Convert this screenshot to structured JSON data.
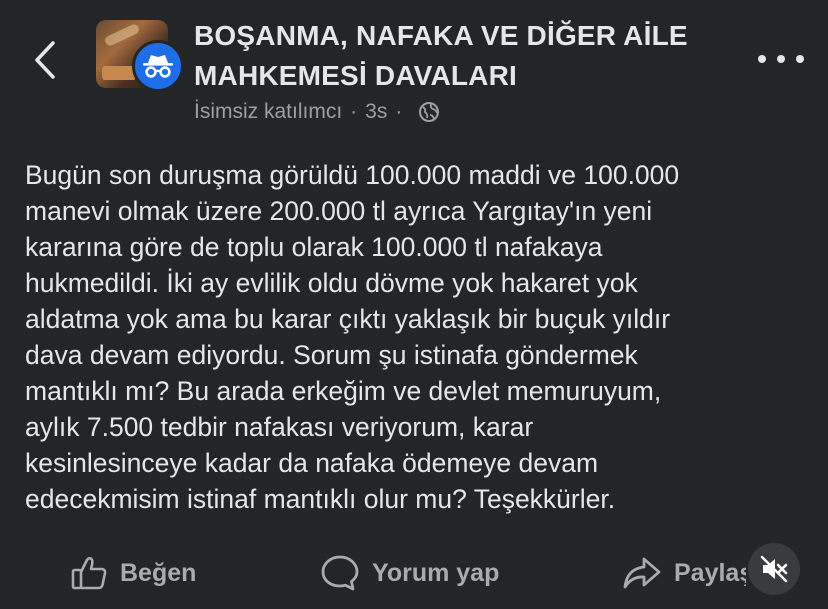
{
  "header": {
    "back_icon": "chevron-left-icon",
    "group_title_line1": "BOŞANMA, NAFAKA VE DİĞER AİLE",
    "group_title_line2": "MAHKEMESİ DAVALARI",
    "author": "İsimsiz katılımcı",
    "separator": "·",
    "time": "3s",
    "privacy_icon": "globe-icon",
    "more_icon": "more-dots-icon"
  },
  "post": {
    "text": "Bugün son duruşma görüldü 100.000 maddi ve 100.000\nmanevi olmak üzere 200.000 tl ayrıca Yargıtay'ın yeni\nkararına göre de toplu olarak 100.000 tl nafakaya\nhukmedildi. İki ay evlilik oldu dövme yok hakaret yok\naldatma yok ama bu karar çıktı yaklaşık bir buçuk yıldır\ndava devam ediyordu. Sorum şu istinafa göndermek\nmantıklı mı? Bu arada erkeğim ve devlet memuruyum,\naylık 7.500 tedbir nafakası veriyorum, karar\nkesinlesinceye kadar da nafaka ödemeye devam\nedecekmisim istinaf mantıklı olur mu? Teşekkürler."
  },
  "actions": {
    "like_label": "Beğen",
    "comment_label": "Yorum yap",
    "share_label": "Paylaş",
    "like_icon": "thumbs-up-icon",
    "comment_icon": "comment-bubble-icon",
    "share_icon": "share-arrow-icon",
    "mute_icon": "muted-speaker-icon"
  },
  "colors": {
    "background": "#242526",
    "primary_text": "#e4e6eb",
    "secondary_text": "#9c9fa4",
    "anonymous_badge": "#1d6ee8"
  }
}
